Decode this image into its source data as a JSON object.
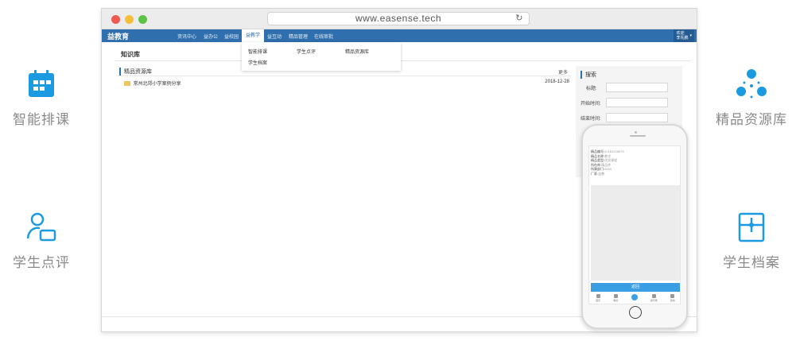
{
  "features": {
    "schedule": {
      "label": "智能排课",
      "icon": "calendar-icon"
    },
    "evaluation": {
      "label": "学生点评",
      "icon": "user-card-icon"
    },
    "resources": {
      "label": "精品资源库",
      "icon": "network-icon"
    },
    "archive": {
      "label": "学生档案",
      "icon": "archive-box-icon"
    }
  },
  "colors": {
    "accent": "#1a9ae0",
    "nav": "#2f6fad",
    "phone_button": "#3a9ee4"
  },
  "browser": {
    "url": "www.easense.tech"
  },
  "app": {
    "brand": "益教育",
    "nav": [
      "资讯中心",
      "益办公",
      "益校园",
      "益教学",
      "益互动",
      "精品管理",
      "在线审批"
    ],
    "active_nav": "益教学",
    "user": {
      "line1": "欢迎",
      "line2": "李先鹏"
    },
    "dropdown": {
      "items": [
        "智能排课",
        "学生点评",
        "精品资源库",
        "学生档案"
      ]
    },
    "page_title": "知识库",
    "panel": {
      "title": "精品资源库",
      "more": "更多",
      "rows": [
        {
          "title": "常州北郊小学案例分享",
          "date": "2018-12-28"
        }
      ]
    },
    "search": {
      "title": "搜索",
      "fields": [
        "标题:",
        "开始时间:",
        "结束时间:"
      ]
    }
  },
  "phone": {
    "details": [
      {
        "label": "精品编号:",
        "value": "20181228075"
      },
      {
        "label": "精品名称:",
        "value": "教学"
      },
      {
        "label": "精品类型:",
        "value": "优质课程"
      },
      {
        "label": "所在库:",
        "value": "精品库"
      },
      {
        "label": "所属部门:",
        "value": "2000"
      },
      {
        "label": "厂家:",
        "value": "益教"
      }
    ],
    "button": "返回",
    "tabs": [
      "首页",
      "审批",
      "",
      "通讯录",
      "我的"
    ]
  }
}
